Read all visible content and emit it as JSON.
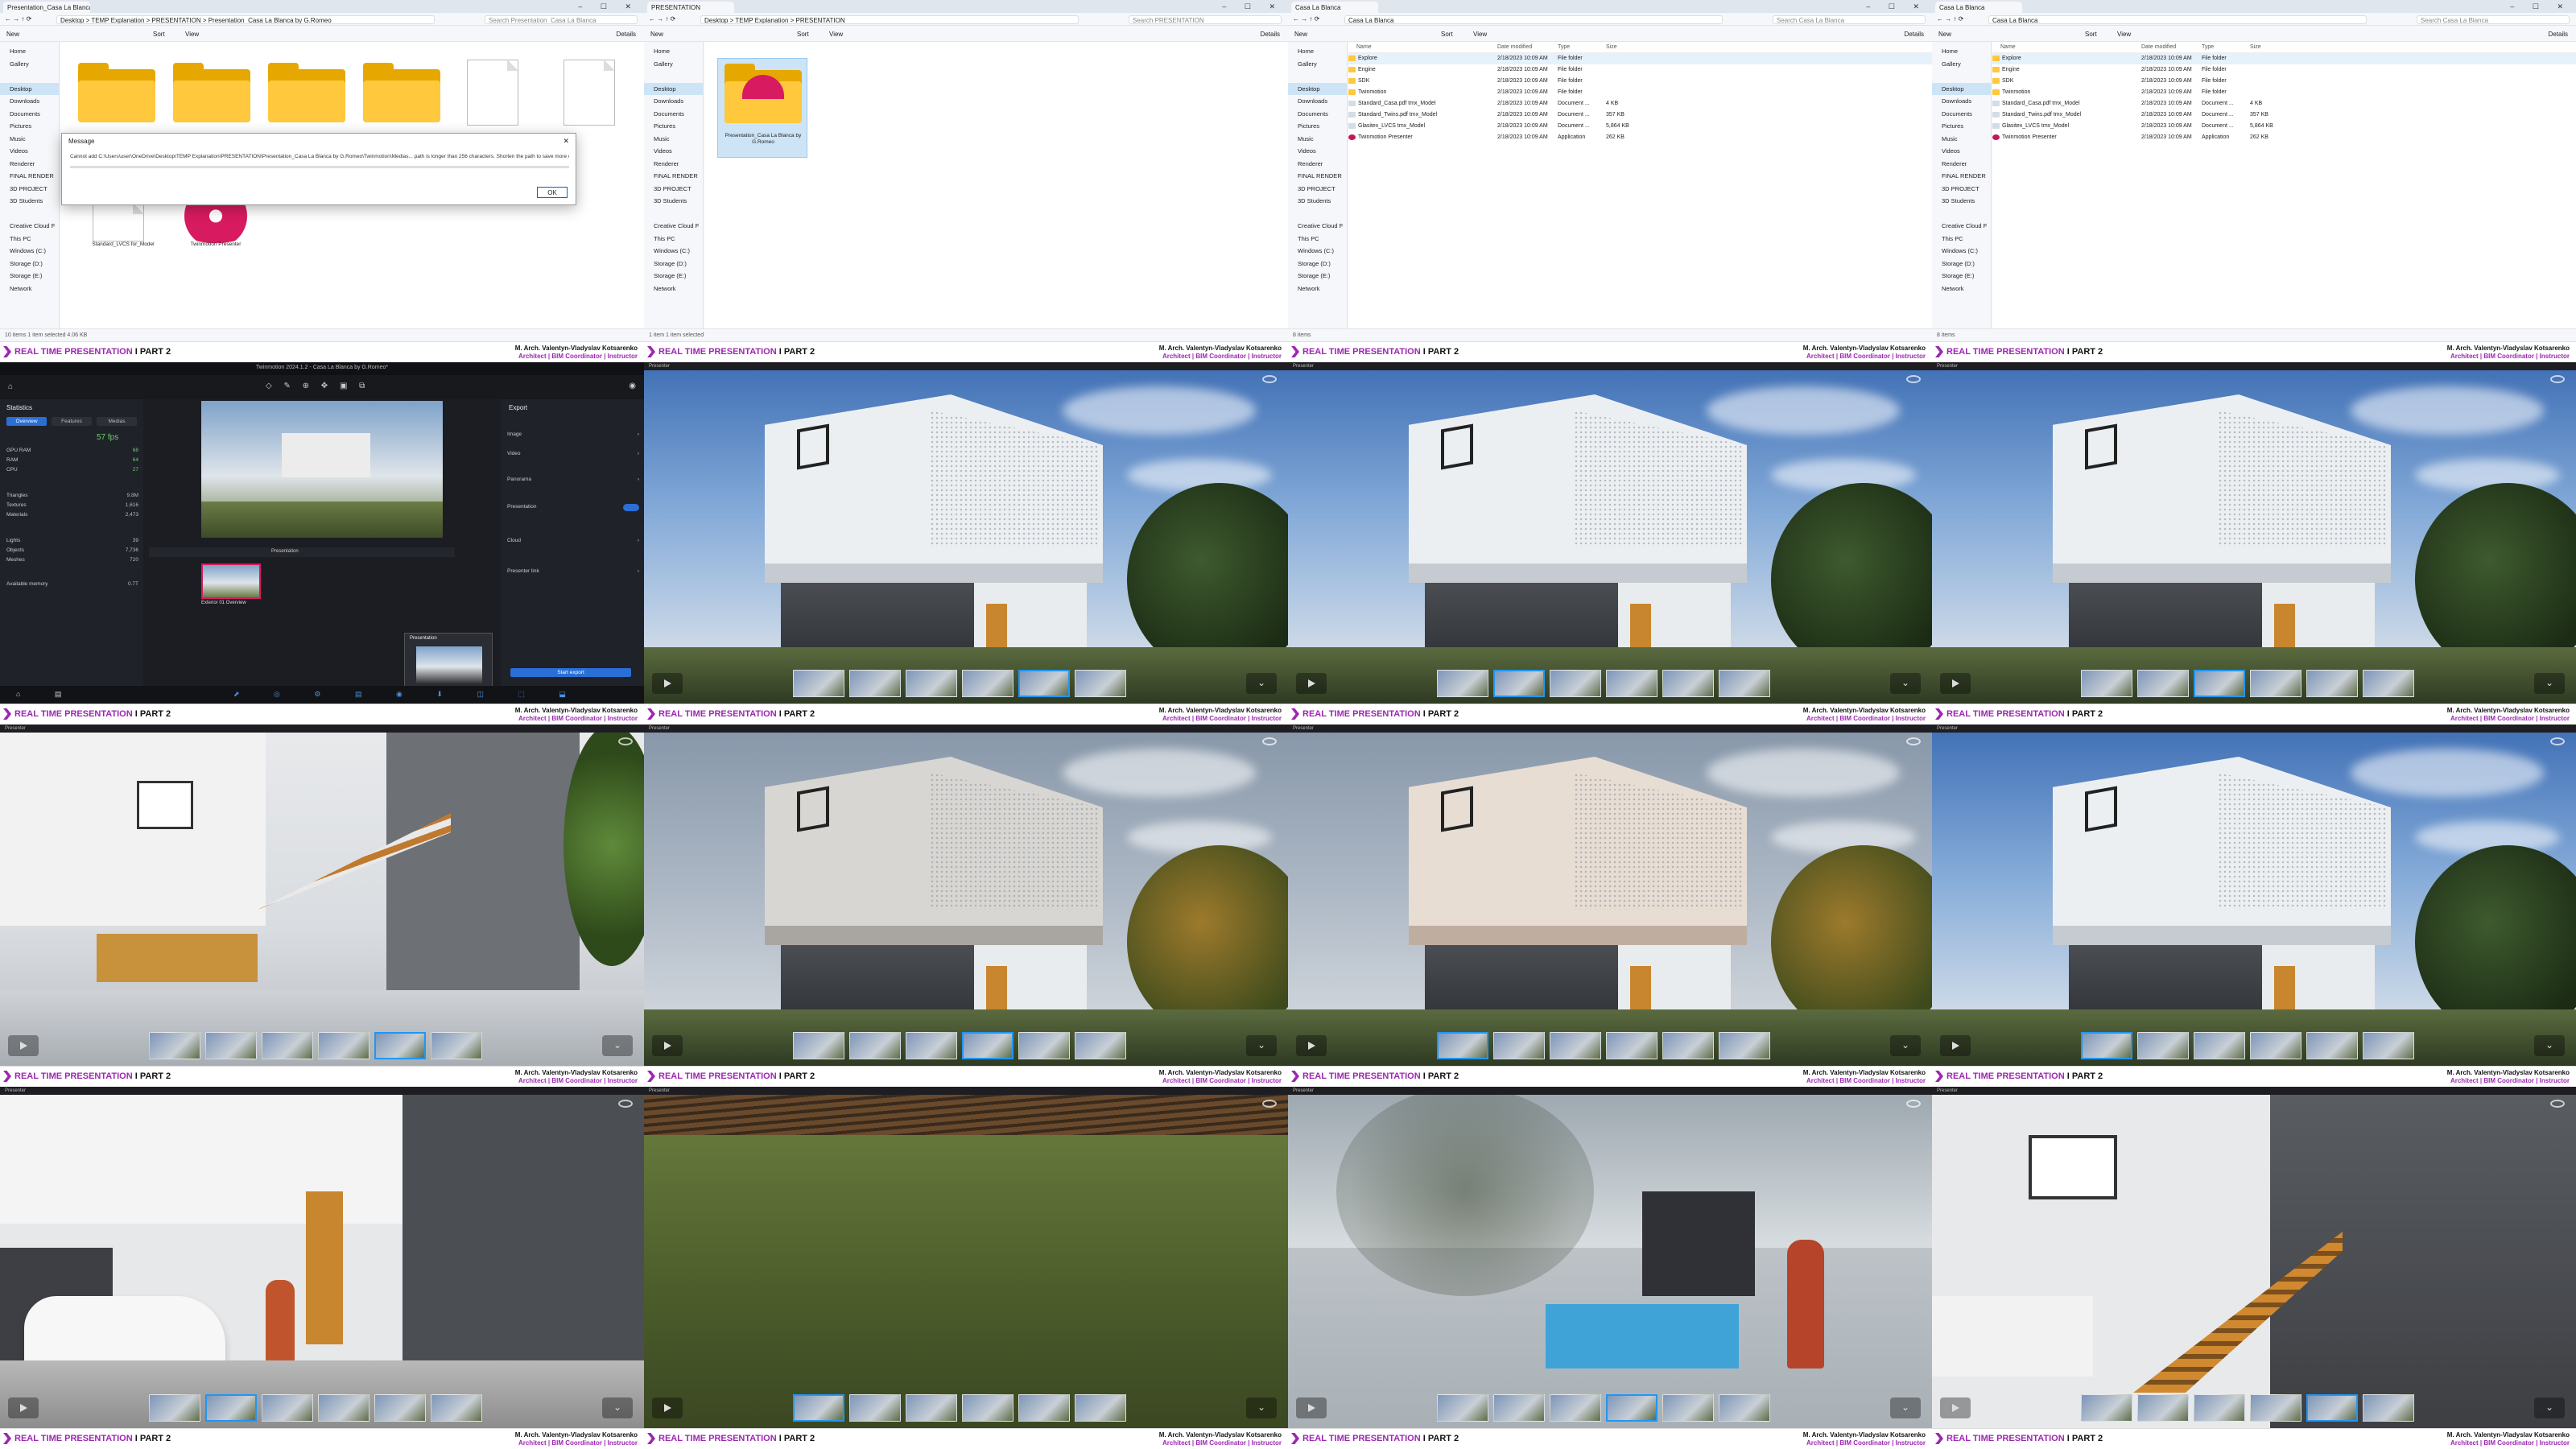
{
  "banner": {
    "title_colored": "REAL TIME PRESENTATION",
    "title_part": "I PART 2",
    "author_line1": "M. Arch. Valentyn-Vladyslav Kotsarenko",
    "author_line2": "Architect | BIM Coordinator | Instructor"
  },
  "explorer1": {
    "tab_title": "Presentation_Casa La Blanca",
    "path": "Desktop  >  TEMP Explanation  >  PRESENTATION  >  Presentation_Casa La Blanca by G.Romeo",
    "search": "Search Presentation_Casa La Blanca",
    "dialog_title": "Message",
    "dialog_text": "Cannot add C:\\Users\\user\\OneDrive\\Desktop\\TEMP Explanation\\PRESENTATION\\Presentation_Casa La Blanca by G.Romeo\\Twinmotion\\Medias... path is longer than 256 characters. Shorten the path to save more characters for external",
    "dialog_ok": "OK",
    "file1": "Standard_LVCS for_Model",
    "file2": "Twinmotion Presenter",
    "status": "10 items   1 item selected  4.06 KB"
  },
  "explorer2": {
    "tab_title": "PRESENTATION",
    "path": "Desktop  >  TEMP Explanation  >  PRESENTATION",
    "search": "Search PRESENTATION",
    "folder_label": "Presentation_Casa La Blanca by G.Romeo",
    "status": "1 item   1 item selected"
  },
  "explorer3": {
    "tab_title": "Casa La Blanca",
    "path": "Casa La Blanca",
    "search": "Search Casa La Blanca",
    "columns": [
      "Name",
      "Date modified",
      "Type",
      "Size"
    ],
    "rows": [
      {
        "name": "Explore",
        "date": "2/18/2023 10:09 AM",
        "type": "File folder",
        "size": "",
        "kind": "folder"
      },
      {
        "name": "Engine",
        "date": "2/18/2023 10:09 AM",
        "type": "File folder",
        "size": "",
        "kind": "folder"
      },
      {
        "name": "SDK",
        "date": "2/18/2023 10:09 AM",
        "type": "File folder",
        "size": "",
        "kind": "folder"
      },
      {
        "name": "Twinmotion",
        "date": "2/18/2023 10:09 AM",
        "type": "File folder",
        "size": "",
        "kind": "folder"
      },
      {
        "name": "Standard_Casa.pdf tmx_Model",
        "date": "2/18/2023 10:09 AM",
        "type": "Document ...",
        "size": "4 KB",
        "kind": "file"
      },
      {
        "name": "Standard_Twins.pdf tmx_Model",
        "date": "2/18/2023 10:09 AM",
        "type": "Document ...",
        "size": "357 KB",
        "kind": "file"
      },
      {
        "name": "Glasitex_LVCS tmx_Model",
        "date": "2/18/2023 10:09 AM",
        "type": "Document ...",
        "size": "5,864 KB",
        "kind": "file"
      },
      {
        "name": "Twinmotion Presenter",
        "date": "2/18/2023 10:09 AM",
        "type": "Application",
        "size": "262 KB",
        "kind": "app"
      }
    ],
    "status": "8 items"
  },
  "explorer4": {
    "tab_title": "Casa La Blanca",
    "path": "Casa La Blanca",
    "search": "Search Casa La Blanca",
    "status": "8 items"
  },
  "nav_items": [
    "Home",
    "Gallery",
    "",
    "Desktop",
    "Downloads",
    "Documents",
    "Pictures",
    "Music",
    "Videos",
    "Renderer",
    "FINAL RENDER",
    "3D PROJECT",
    "3D Students",
    "",
    "Creative Cloud F",
    "This PC",
    "Windows (C:)",
    "Storage (D:)",
    "Storage (E:)",
    "Network"
  ],
  "cmd": {
    "new": "New",
    "sort": "Sort",
    "view": "View",
    "details": "Details"
  },
  "twinmotion": {
    "title": "Twinmotion 2024.1.2 - Casa La Blanca by G.Romeo*",
    "panel_title": "Statistics",
    "tabs": [
      "Overview",
      "Features",
      "Medias"
    ],
    "fps": "57 fps",
    "stats": [
      {
        "label": "GPU RAM",
        "value": "68"
      },
      {
        "label": "RAM",
        "value": "64"
      },
      {
        "label": "CPU",
        "value": "27"
      },
      {
        "label": "Triangles",
        "value": "9.8M"
      },
      {
        "label": "Textures",
        "value": "1,616"
      },
      {
        "label": "Materials",
        "value": "2,473"
      },
      {
        "label": "Lights",
        "value": "39"
      },
      {
        "label": "Objects",
        "value": "7,736"
      },
      {
        "label": "Meshes",
        "value": "720"
      },
      {
        "label": "Available memory",
        "value": "0.7T"
      }
    ],
    "export_title": "Export",
    "export_items": [
      "Image",
      "Video",
      "Panorama",
      "Presentation",
      "Cloud",
      "Presenter link"
    ],
    "start_export": "Start export",
    "presentation_label": "Presentation",
    "media_label": "Exterior 01 Overview",
    "popup_label": "Presentation"
  },
  "viewer": {
    "top_label": "Presenter"
  },
  "colors": {
    "accent": "#9c27b0",
    "selection": "#2196f3"
  }
}
